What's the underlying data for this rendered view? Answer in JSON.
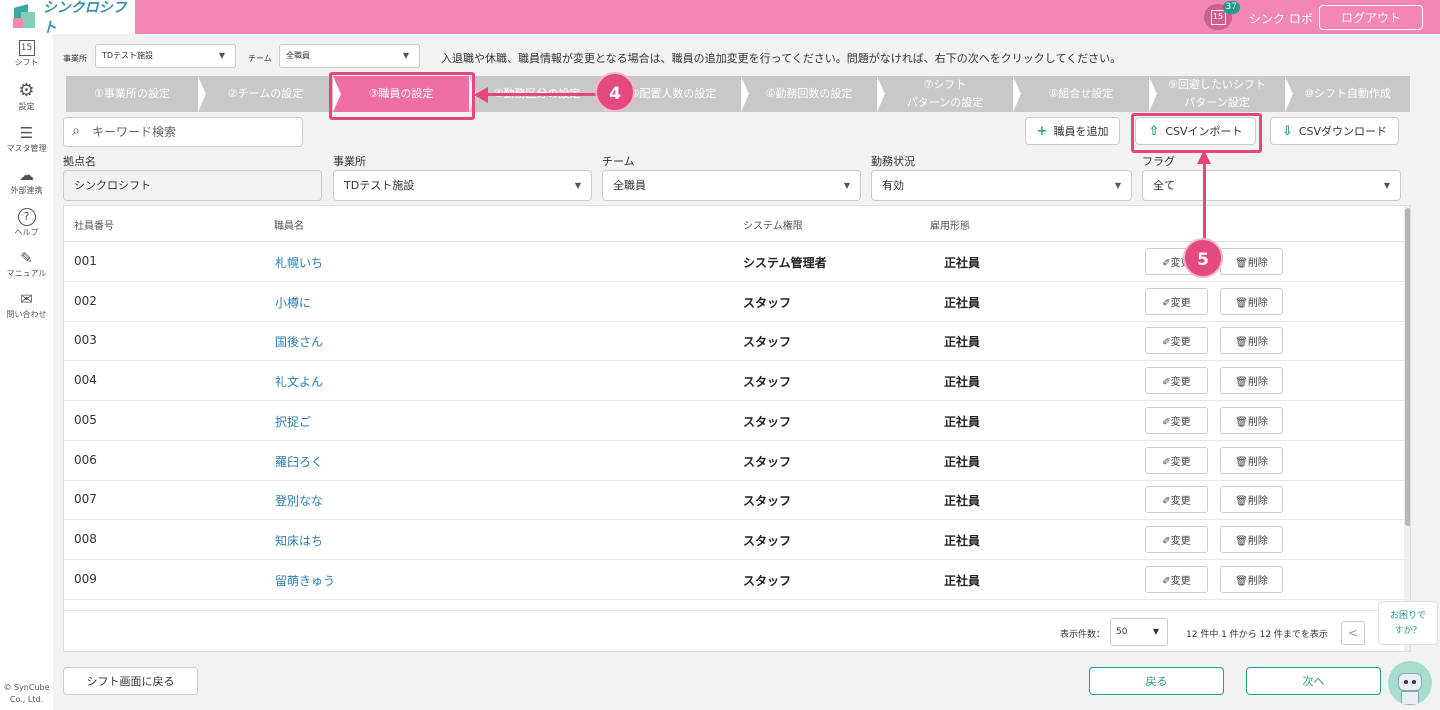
{
  "app": {
    "logo_text": "シンクロシフト",
    "calendar_day": "15",
    "notification_count": "37",
    "user_name": "シンク ロボ",
    "logout_label": "ログアウト"
  },
  "sidebar": {
    "items": [
      {
        "icon": "calendar-icon",
        "label": "シフト",
        "glyph": "15"
      },
      {
        "icon": "gear-icon",
        "label": "設定",
        "glyph": "⚙"
      },
      {
        "icon": "database-icon",
        "label": "マスタ管理",
        "glyph": "☰"
      },
      {
        "icon": "cloud-icon",
        "label": "外部連携",
        "glyph": "☁"
      },
      {
        "icon": "help-icon",
        "label": "ヘルプ",
        "glyph": "?"
      },
      {
        "icon": "manual-icon",
        "label": "マニュアル",
        "glyph": "✎"
      },
      {
        "icon": "mail-icon",
        "label": "問い合わせ",
        "glyph": "✉"
      }
    ],
    "copyright_line1": "© SynCube",
    "copyright_line2": "Co., Ltd."
  },
  "top_filters": {
    "facility_label": "事業所",
    "facility_value": "TDテスト施設",
    "team_label": "チーム",
    "team_value": "全職員"
  },
  "notice": "入退職や休職、職員情報が変更となる場合は、職員の追加変更を行ってください。問題がなければ、右下の次へをクリックしてください。",
  "steps": [
    {
      "label": "①事業所の設定"
    },
    {
      "label": "②チームの設定"
    },
    {
      "label": "③職員の設定"
    },
    {
      "label": "④勤務区分の設定"
    },
    {
      "label": "⑤配置人数の設定"
    },
    {
      "label": "⑥勤務回数の設定"
    },
    {
      "label": "⑦シフト",
      "label2": "パターンの設定"
    },
    {
      "label": "⑧組合せ設定"
    },
    {
      "label": "⑨回避したいシフト",
      "label2": "パターン設定"
    },
    {
      "label": "⑩シフト自動作成"
    }
  ],
  "callouts": {
    "step4": "4",
    "step5": "5"
  },
  "search": {
    "placeholder": "キーワード検索"
  },
  "actions": {
    "add": "職員を追加",
    "import": "CSVインポート",
    "download": "CSVダウンロード"
  },
  "filters": {
    "base_label": "拠点名",
    "base_value": "シンクロシフト",
    "facility_label": "事業所",
    "facility_value": "TDテスト施設",
    "team_label": "チーム",
    "team_value": "全職員",
    "status_label": "勤務状況",
    "status_value": "有効",
    "flag_label": "フラグ",
    "flag_value": "全て"
  },
  "table": {
    "headers": {
      "id": "社員番号",
      "name": "職員名",
      "role": "システム権限",
      "type": "雇用形態"
    },
    "edit_label": "✐変更",
    "delete_label": "🗑削除",
    "rows": [
      {
        "id": "001",
        "name": "札幌いち",
        "role": "システム管理者",
        "type": "正社員"
      },
      {
        "id": "002",
        "name": "小樽に",
        "role": "スタッフ",
        "type": "正社員"
      },
      {
        "id": "003",
        "name": "国後さん",
        "role": "スタッフ",
        "type": "正社員"
      },
      {
        "id": "004",
        "name": "礼文よん",
        "role": "スタッフ",
        "type": "正社員"
      },
      {
        "id": "005",
        "name": "択捉ご",
        "role": "スタッフ",
        "type": "正社員"
      },
      {
        "id": "006",
        "name": "羅臼ろく",
        "role": "スタッフ",
        "type": "正社員"
      },
      {
        "id": "007",
        "name": "登別なな",
        "role": "スタッフ",
        "type": "正社員"
      },
      {
        "id": "008",
        "name": "知床はち",
        "role": "スタッフ",
        "type": "正社員"
      },
      {
        "id": "009",
        "name": "留萌きゅう",
        "role": "スタッフ",
        "type": "正社員"
      }
    ]
  },
  "pager": {
    "per_page_label": "表示件数：",
    "per_page_value": "50",
    "info": "12 件中 1 件から 12 件までを表示",
    "prev": "<"
  },
  "footer": {
    "back_to_shift": "シフト画面に戻る",
    "back": "戻る",
    "next": "次へ"
  },
  "help": {
    "line1": "お困りで",
    "line2": "すか？"
  }
}
